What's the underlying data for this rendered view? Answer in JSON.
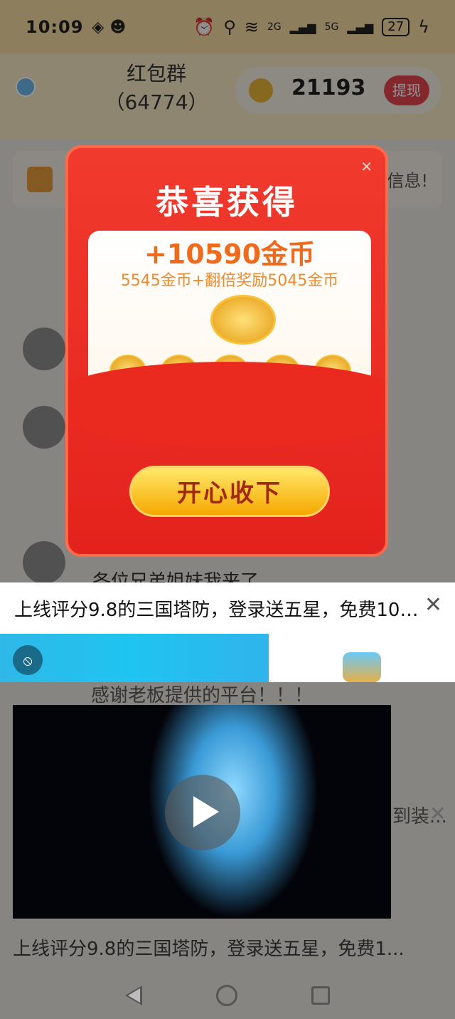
{
  "status_bar": {
    "time": "10:09",
    "battery": "27",
    "network_2g": "2G",
    "network_5g": "5G"
  },
  "header": {
    "group_name": "红包群",
    "group_count": "（64774）",
    "coins": "21193",
    "withdraw_label": "提现"
  },
  "notice": {
    "text": "信息!"
  },
  "chat": {
    "message_1": "各位兄弟姐妹我来了",
    "message_2": "感谢老板提供的平台！！！",
    "side_text": "到装..."
  },
  "modal": {
    "title": "恭喜获得",
    "reward": "+10590金币",
    "breakdown": "5545金币+翻倍奖励5045金币",
    "claim_label": "开心收下",
    "coin_symbol": "¥"
  },
  "ad": {
    "headline": "上线评分9.8的三国塔防，登录送五星，免费100...",
    "bottom_headline": "上线评分9.8的三国塔防，登录送五星，免费1..."
  },
  "colors": {
    "accent_red": "#e4221d",
    "gold": "#f6a800",
    "withdraw_bg": "#e3454e"
  }
}
